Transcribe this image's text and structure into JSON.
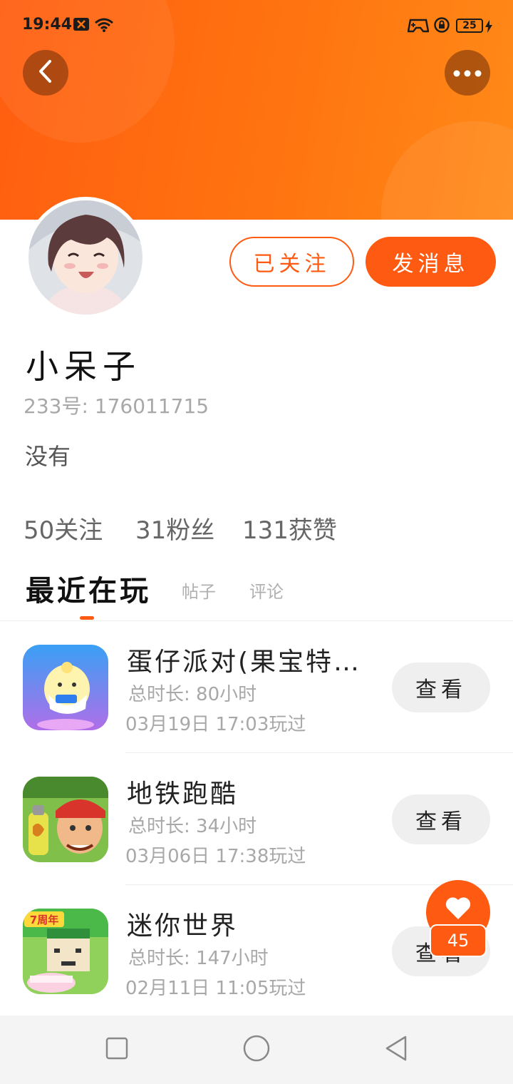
{
  "status_bar": {
    "time": "19:44",
    "battery": "25"
  },
  "header": {
    "back_icon": "chevron-left-icon",
    "more_icon": "more-horizontal-icon",
    "accent": "#ff5a12"
  },
  "profile": {
    "nickname": "小呆子",
    "uid": "233号: 176011715",
    "bio": "没有",
    "follow_button": "已关注",
    "message_button": "发消息"
  },
  "stats": {
    "following": "50关注",
    "fans": "31粉丝",
    "likes": "131获赞"
  },
  "tabs": [
    {
      "label": "最近在玩",
      "active": true
    },
    {
      "label": "帖子",
      "active": false
    },
    {
      "label": "评论",
      "active": false
    }
  ],
  "games": [
    {
      "title": "蛋仔派对(果宝特…",
      "total_time": "总时长: 80小时",
      "last_played": "03月19日 17:03玩过",
      "action": "查看"
    },
    {
      "title": "地铁跑酷",
      "total_time": "总时长: 34小时",
      "last_played": "03月06日 17:38玩过",
      "action": "查看"
    },
    {
      "title": "迷你世界",
      "total_time": "总时长: 147小时",
      "last_played": "02月11日 11:05玩过",
      "action": "查看"
    }
  ],
  "like_fab": {
    "count": "45",
    "icon": "heart-icon"
  },
  "game_icon_labels": {
    "mini_world_badge": "7周年"
  }
}
